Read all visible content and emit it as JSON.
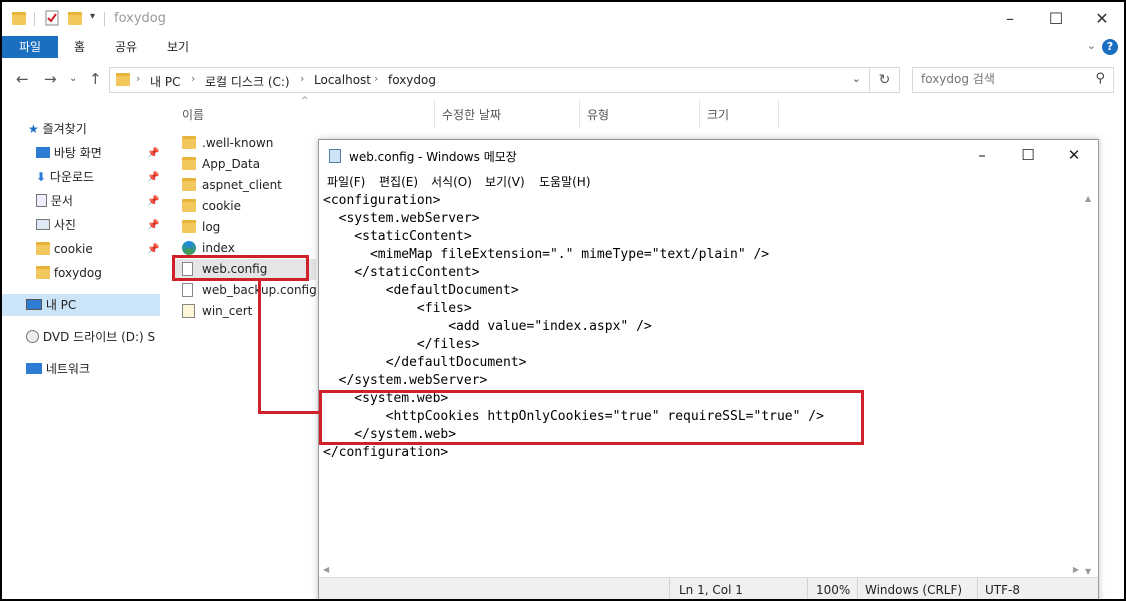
{
  "explorer": {
    "window_title": "foxydog",
    "ribbon_tabs": [
      "파일",
      "홈",
      "공유",
      "보기"
    ],
    "breadcrumb": [
      "내 PC",
      "로컬 디스크 (C:)",
      "Localhost",
      "foxydog"
    ],
    "search_placeholder": "foxydog 검색",
    "nav_items": [
      "즐겨찾기",
      "바탕 화면",
      "다운로드",
      "문서",
      "사진",
      "cookie",
      "foxydog",
      "내 PC",
      "DVD 드라이브 (D:) S",
      "네트워크"
    ],
    "columns": [
      "이름",
      "수정한 날짜",
      "유형",
      "크기"
    ],
    "files": [
      {
        "name": ".well-known",
        "icon": "folder-icon"
      },
      {
        "name": "App_Data",
        "icon": "folder-icon"
      },
      {
        "name": "aspnet_client",
        "icon": "folder-icon"
      },
      {
        "name": "cookie",
        "icon": "folder-icon"
      },
      {
        "name": "log",
        "icon": "folder-icon"
      },
      {
        "name": "index",
        "icon": "edge-icon"
      },
      {
        "name": "web.config",
        "icon": "file-icon"
      },
      {
        "name": "web_backup.config",
        "icon": "file-icon"
      },
      {
        "name": "win_cert",
        "icon": "config-icon"
      }
    ],
    "selected_file": "web.config"
  },
  "notepad": {
    "title": "web.config - Windows 메모장",
    "menu": [
      "파일(F)",
      "편집(E)",
      "서식(O)",
      "보기(V)",
      "도움말(H)"
    ],
    "content": "<configuration>\n  <system.webServer>\n    <staticContent>\n      <mimeMap fileExtension=\".\" mimeType=\"text/plain\" />\n    </staticContent>\n        <defaultDocument>\n            <files>\n                <add value=\"index.aspx\" />\n            </files>\n        </defaultDocument>\n  </system.webServer>\n    <system.web>\n        <httpCookies httpOnlyCookies=\"true\" requireSSL=\"true\" />\n    </system.web>\n</configuration>",
    "status": {
      "position": "Ln 1, Col 1",
      "zoom": "100%",
      "line_ending": "Windows (CRLF)",
      "encoding": "UTF-8"
    }
  },
  "colors": {
    "accent": "#1a6fc1",
    "annotation": "#d0202a",
    "selection": "#cce4f7"
  }
}
